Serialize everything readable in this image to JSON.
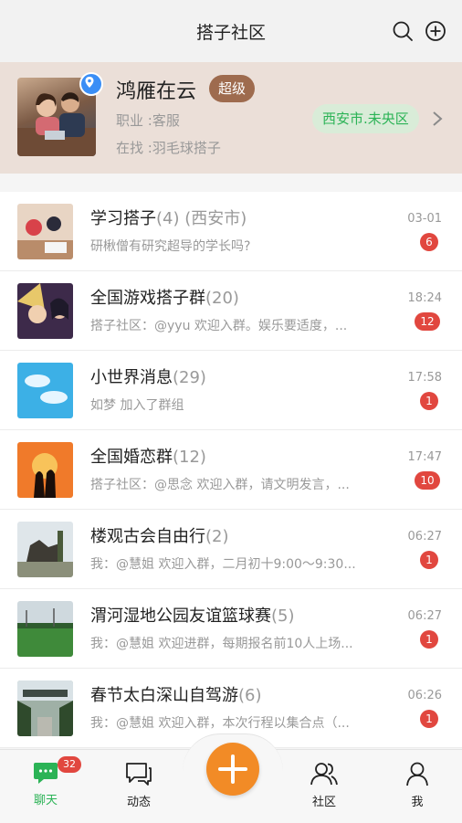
{
  "header": {
    "title": "搭子社区"
  },
  "profile": {
    "name": "鸿雁在云",
    "level_badge": "超级",
    "job": "职业 :客服",
    "seeking": "在找 :羽毛球搭子",
    "region": "西安市.未央区"
  },
  "chats": [
    {
      "title": "学习搭子",
      "count": "(4) (西安市)",
      "subtitle": "研楸僧有研究超导的学长吗?",
      "time": "03-01",
      "unread": "6"
    },
    {
      "title": "全国游戏搭子群",
      "count": "(20)",
      "subtitle": "搭子社区：@yyu 欢迎入群。娱乐要适度，...",
      "time": "18:24",
      "unread": "12"
    },
    {
      "title": "小世界消息",
      "count": "(29)",
      "subtitle": "如梦 加入了群组",
      "time": "17:58",
      "unread": "1"
    },
    {
      "title": "全国婚恋群",
      "count": "(12)",
      "subtitle": "搭子社区：@思念 欢迎入群，请文明发言，...",
      "time": "17:47",
      "unread": "10"
    },
    {
      "title": "楼观古会自由行",
      "count": "(2)",
      "subtitle": "我：@慧姐 欢迎入群，二月初十9:00～9:30...",
      "time": "06:27",
      "unread": "1"
    },
    {
      "title": "渭河湿地公园友谊篮球赛",
      "count": "(5)",
      "subtitle": "我：@慧姐 欢迎进群，每期报名前10人上场...",
      "time": "06:27",
      "unread": "1"
    },
    {
      "title": "春节太白深山自驾游",
      "count": "(6)",
      "subtitle": "我：@慧姐 欢迎入群，本次行程以集合点（...",
      "time": "06:26",
      "unread": "1"
    }
  ],
  "tabs": {
    "chat": "聊天",
    "chat_badge": "32",
    "moments": "动态",
    "community": "社区",
    "me": "我"
  },
  "colors": {
    "accent_green": "#2bb356",
    "badge_red": "#e1473f",
    "fab_orange": "#f28b26"
  },
  "icons": [
    "search-icon",
    "add-circle-icon",
    "location-pin-icon",
    "chevron-right-icon",
    "chat-bubble-icon",
    "moments-icon",
    "plus-icon",
    "community-icon",
    "user-icon"
  ]
}
